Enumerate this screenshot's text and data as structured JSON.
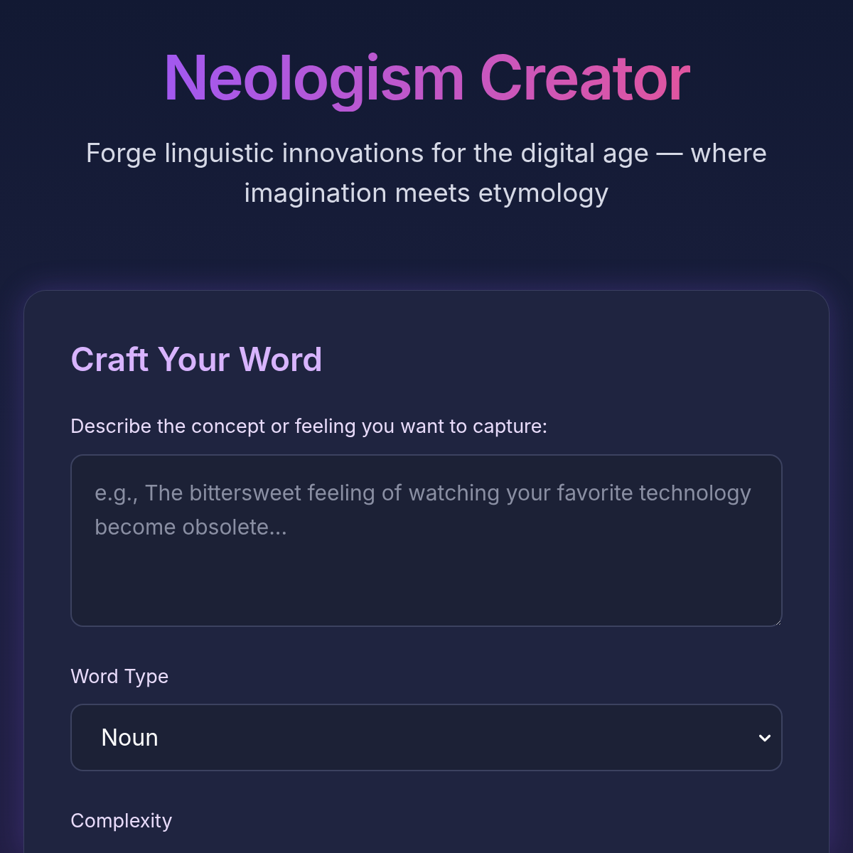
{
  "header": {
    "title": "Neologism Creator",
    "subtitle": "Forge linguistic innovations for the digital age — where imagination meets etymology"
  },
  "form": {
    "heading": "Craft Your Word",
    "concept": {
      "label": "Describe the concept or feeling you want to capture:",
      "placeholder": "e.g., The bittersweet feeling of watching your favorite technology become obsolete..."
    },
    "word_type": {
      "label": "Word Type",
      "value": "Noun"
    },
    "complexity": {
      "label": "Complexity"
    }
  }
}
